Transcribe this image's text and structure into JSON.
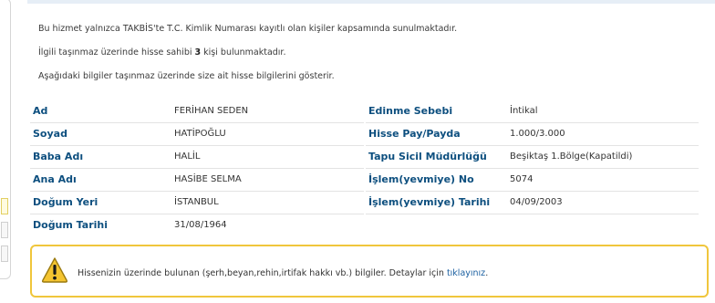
{
  "intro": {
    "line1": "Bu hizmet yalnızca TAKBİS'te T.C. Kimlik Numarası kayıtlı olan kişiler kapsamında sunulmaktadır.",
    "line2_pre": "İlgili taşınmaz üzerinde hisse sahibi ",
    "line2_count": "3",
    "line2_post": " kişi bulunmaktadır.",
    "line3": "Aşağıdaki bilgiler taşınmaz üzerinde size ait hisse bilgilerini gösterir."
  },
  "left_fields": [
    {
      "label": "Ad",
      "value": "FERİHAN SEDEN"
    },
    {
      "label": "Soyad",
      "value": "HATİPOĞLU"
    },
    {
      "label": "Baba Adı",
      "value": "HALİL"
    },
    {
      "label": "Ana Adı",
      "value": "HASİBE SELMA"
    },
    {
      "label": "Doğum Yeri",
      "value": "İSTANBUL"
    },
    {
      "label": "Doğum Tarihi",
      "value": "31/08/1964"
    }
  ],
  "right_fields": [
    {
      "label": "Edinme Sebebi",
      "value": "İntikal"
    },
    {
      "label": "Hisse Pay/Payda",
      "value": "1.000/3.000"
    },
    {
      "label": "Tapu Sicil Müdürlüğü",
      "value": "Beşiktaş 1.Bölge(Kapatildi)"
    },
    {
      "label": "İşlem(yevmiye) No",
      "value": "5074"
    },
    {
      "label": "İşlem(yevmiye) Tarihi",
      "value": "04/09/2003"
    }
  ],
  "warning": {
    "text": "Hissenizin üzerinde bulunan (şerh,beyan,rehin,irtifak hakkı vb.) bilgiler. Detaylar için ",
    "link": "tıklayınız",
    "suffix": "."
  },
  "colors": {
    "label": "#0d4f7f",
    "warning_border": "#f0c63c",
    "link": "#1a5fa0"
  }
}
